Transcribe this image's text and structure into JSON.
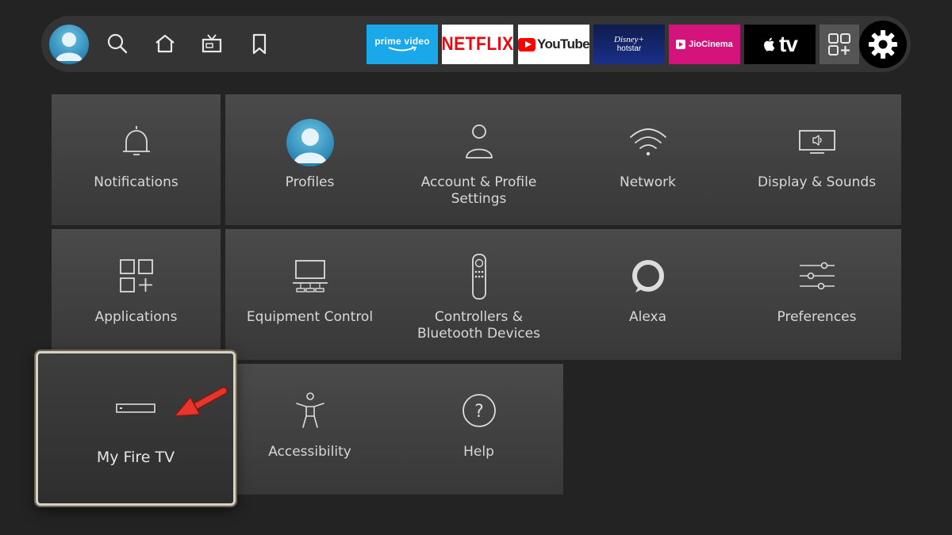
{
  "topbar": {
    "nav_icons": [
      "user-avatar",
      "search-icon",
      "home-icon",
      "live-tv-icon",
      "bookmark-icon"
    ],
    "apps": [
      {
        "id": "prime",
        "label": "prime video",
        "color": "#1aa8ea"
      },
      {
        "id": "netflix",
        "label": "NETFLIX",
        "color": "#e50914"
      },
      {
        "id": "youtube",
        "label": "YouTube",
        "color": "#ff0000"
      },
      {
        "id": "hotstar",
        "label_top": "Disney+",
        "label_bottom": "hotstar",
        "color": "#0e1c4d"
      },
      {
        "id": "jiocinema",
        "label": "JioCinema",
        "color": "#d4137c"
      },
      {
        "id": "appletv",
        "label": "tv",
        "color": "#000000"
      }
    ],
    "more_apps_icon": "apps-grid-icon",
    "settings_icon": "gear-icon"
  },
  "tiles": [
    {
      "label": "Notifications",
      "icon": "bell-icon"
    },
    {
      "label": "Profiles",
      "icon": "profile-avatar-icon"
    },
    {
      "label": "Account & Profile Settings",
      "icon": "user-outline-icon"
    },
    {
      "label": "Network",
      "icon": "wifi-icon"
    },
    {
      "label": "Display & Sounds",
      "icon": "tv-speaker-icon"
    },
    {
      "label": "Applications",
      "icon": "apps-grid-icon"
    },
    {
      "label": "Equipment Control",
      "icon": "monitor-soundbar-icon"
    },
    {
      "label": "Controllers & Bluetooth Devices",
      "icon": "remote-icon"
    },
    {
      "label": "Alexa",
      "icon": "alexa-ring-icon"
    },
    {
      "label": "Preferences",
      "icon": "sliders-icon"
    },
    {
      "label": "My Fire TV",
      "icon": "fire-tv-device-icon",
      "focused": true
    },
    {
      "label": "Accessibility",
      "icon": "accessibility-icon"
    },
    {
      "label": "Help",
      "icon": "help-circle-icon"
    }
  ],
  "annotation": {
    "arrow_color": "#e8352b",
    "arrow_icon": "red-arrow-icon"
  }
}
